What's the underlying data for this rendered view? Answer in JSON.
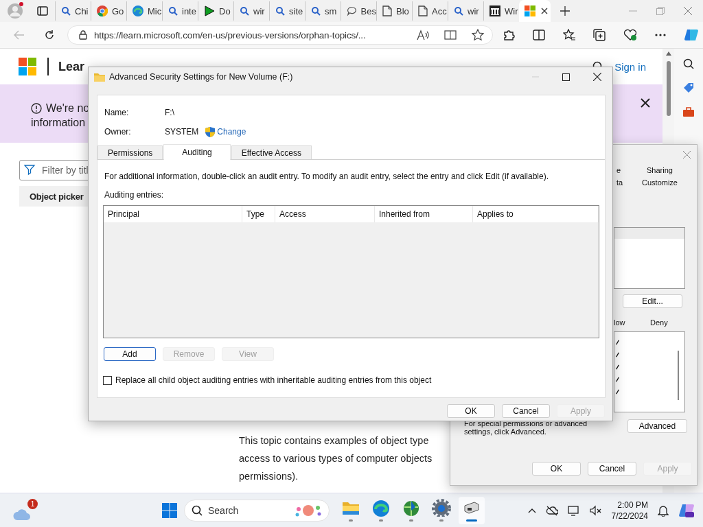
{
  "browser": {
    "tabs": [
      {
        "kind": "search",
        "label": "Chi",
        "selected": false
      },
      {
        "kind": "chrome",
        "label": "Go",
        "selected": false
      },
      {
        "kind": "edge",
        "label": "Mic",
        "selected": false
      },
      {
        "kind": "search",
        "label": "inte",
        "selected": false
      },
      {
        "kind": "play",
        "label": "Do",
        "selected": false
      },
      {
        "kind": "search",
        "label": "wir",
        "selected": false
      },
      {
        "kind": "search",
        "label": "site",
        "selected": false
      },
      {
        "kind": "search",
        "label": "sm",
        "selected": false
      },
      {
        "kind": "chat",
        "label": "Bes",
        "selected": false
      },
      {
        "kind": "doc",
        "label": "Blo",
        "selected": false
      },
      {
        "kind": "doc",
        "label": "Acc",
        "selected": false
      },
      {
        "kind": "search",
        "label": "wir",
        "selected": false
      },
      {
        "kind": "museum",
        "label": "Wir",
        "selected": false
      },
      {
        "kind": "windows",
        "selected": true
      }
    ],
    "url": "https://learn.microsoft.com/en-us/previous-versions/orphan-topics/..."
  },
  "page": {
    "brand": "Lear",
    "sign_in": "Sign in",
    "banner": [
      "We're no",
      "information"
    ],
    "filter_placeholder": "Filter by titl",
    "toc_item": "Object picker",
    "paragraph": [
      "This topic contains examples of object type",
      "access to various types of computer objects",
      "permissions)."
    ]
  },
  "dialog": {
    "title": "Advanced Security Settings for New Volume (F:)",
    "fields": [
      {
        "label": "Name:",
        "value": "F:\\"
      },
      {
        "label": "Owner:",
        "value": "SYSTEM",
        "link": "Change"
      }
    ],
    "tabs": [
      {
        "label": "Permissions",
        "selected": false
      },
      {
        "label": "Auditing",
        "selected": true
      },
      {
        "label": "Effective Access",
        "selected": false
      }
    ],
    "info": "For additional information, double-click an audit entry. To modify an audit entry, select the entry and click Edit (if available).",
    "list_label": "Auditing entries:",
    "columns": [
      "Principal",
      "Type",
      "Access",
      "Inherited from",
      "Applies to"
    ],
    "buttons": [
      {
        "label": "Add",
        "disabled": false
      },
      {
        "label": "Remove",
        "disabled": true
      },
      {
        "label": "View",
        "disabled": true
      }
    ],
    "checkbox": {
      "label": "Replace all child object auditing entries with inheritable auditing entries from this object",
      "checked": false
    },
    "footer": [
      {
        "label": "OK",
        "disabled": false
      },
      {
        "label": "Cancel",
        "disabled": false
      },
      {
        "label": "Apply",
        "disabled": true
      }
    ]
  },
  "properties": {
    "tabs": [
      [
        "e",
        "Sharing"
      ],
      [
        "ta",
        "Customize"
      ]
    ],
    "edit_button": "Edit...",
    "columns": [
      "low",
      "Deny"
    ],
    "rows": [
      {
        "allow": true,
        "deny": false
      },
      {
        "allow": true,
        "deny": false
      },
      {
        "allow": true,
        "deny": false
      },
      {
        "allow": true,
        "deny": false
      },
      {
        "allow": true,
        "deny": false
      }
    ],
    "hint": "For special permissions or advanced settings, click Advanced.",
    "advanced_button": "Advanced",
    "footer": [
      {
        "label": "OK",
        "disabled": false
      },
      {
        "label": "Cancel",
        "disabled": false
      },
      {
        "label": "Apply",
        "disabled": true
      }
    ]
  },
  "taskbar": {
    "weather_badge": "1",
    "search_label": "Search",
    "apps": [
      {
        "kind": "folder",
        "selected": false
      },
      {
        "kind": "edge",
        "selected": false
      },
      {
        "kind": "globe",
        "selected": false
      },
      {
        "kind": "gear",
        "selected": false
      },
      {
        "kind": "device",
        "selected": true
      }
    ],
    "time": "2:00 PM",
    "date": "7/22/2024"
  }
}
